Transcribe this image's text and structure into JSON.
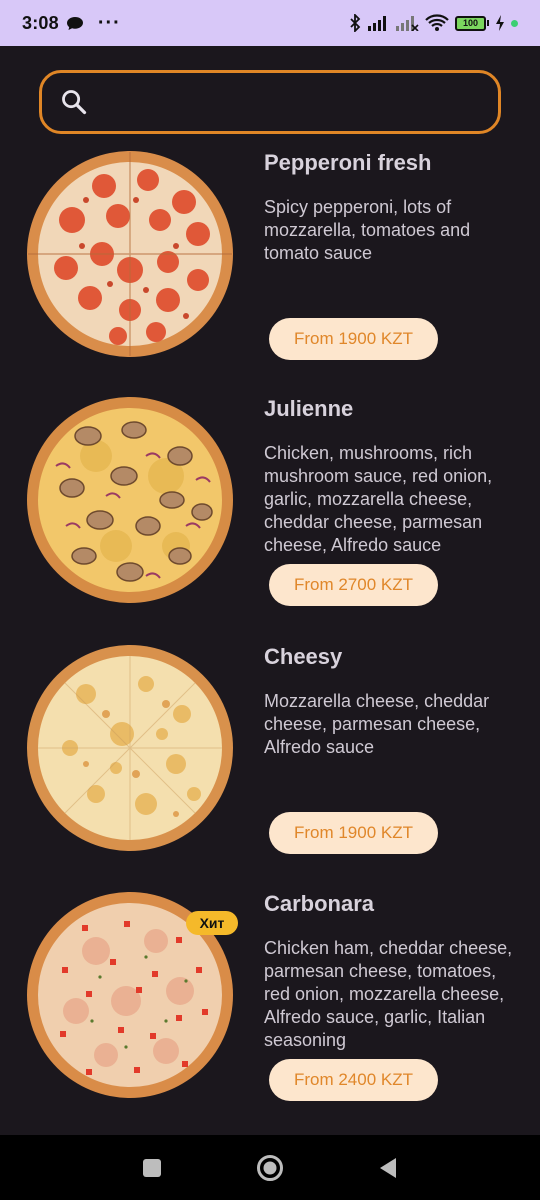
{
  "status": {
    "time": "3:08",
    "more": "···",
    "battery": "100"
  },
  "search": {
    "placeholder": ""
  },
  "menu": [
    {
      "title": "Pepperoni fresh",
      "description": "Spicy pepperoni, lots of mozzarella, tomatoes and tomato sauce",
      "price": "From 1900 KZT",
      "badge": "",
      "image": "pepperoni-pizza"
    },
    {
      "title": "Julienne",
      "description": "Chicken, mushrooms, rich mushroom sauce, red onion, garlic, mozzarella cheese, cheddar cheese, parmesan cheese, Alfredo sauce",
      "price": "From 2700 KZT",
      "badge": "",
      "image": "julienne-pizza"
    },
    {
      "title": "Cheesy",
      "description": "Mozzarella cheese, cheddar cheese, parmesan cheese, Alfredo sauce",
      "price": "From 1900 KZT",
      "badge": "",
      "image": "cheese-pizza"
    },
    {
      "title": "Carbonara",
      "description": "Chicken ham, cheddar cheese, parmesan cheese, tomatoes, red onion, mozzarella cheese, Alfredo sauce, garlic, Italian seasoning",
      "price": "From 2400 KZT",
      "badge": "Хит",
      "image": "carbonara-pizza"
    }
  ],
  "colors": {
    "background": "#1b171d",
    "accent": "#e08626",
    "price_bg": "#fde6cd",
    "badge": "#f5b92a",
    "status_bar": "#d8c8f8"
  }
}
